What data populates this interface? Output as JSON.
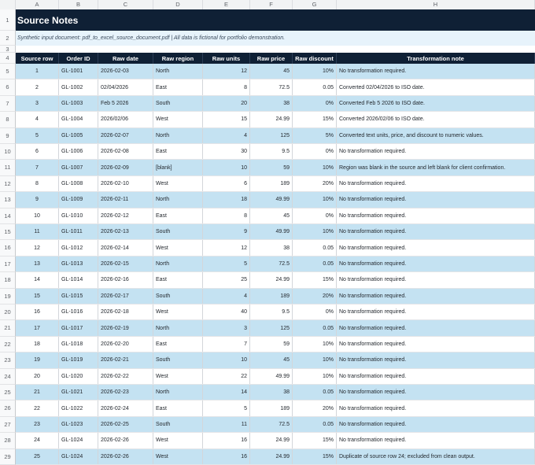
{
  "columns": [
    "A",
    "B",
    "C",
    "D",
    "E",
    "F",
    "G",
    "H"
  ],
  "title": "Source Notes",
  "subtitle": "Synthetic input document: pdf_to_excel_source_document.pdf | All data is fictional for portfolio demonstration.",
  "headers": [
    "Source row",
    "Order ID",
    "Raw date",
    "Raw region",
    "Raw units",
    "Raw price",
    "Raw discount",
    "Transformation note"
  ],
  "row_numbers": [
    "1",
    "2",
    "3",
    "4",
    "5",
    "6",
    "7",
    "8",
    "9",
    "10",
    "11",
    "12",
    "13",
    "14",
    "15",
    "16",
    "17",
    "18",
    "19",
    "20",
    "21",
    "22",
    "23",
    "24",
    "25",
    "26",
    "27",
    "28",
    "29"
  ],
  "rows": [
    [
      "1",
      "GL-1001",
      "2026-02-03",
      "North",
      "12",
      "45",
      "10%",
      "No transformation required."
    ],
    [
      "2",
      "GL-1002",
      "02/04/2026",
      "East",
      "8",
      "72.5",
      "0.05",
      "Converted 02/04/2026 to ISO date."
    ],
    [
      "3",
      "GL-1003",
      "Feb 5 2026",
      "South",
      "20",
      "38",
      "0%",
      "Converted Feb 5 2026 to ISO date."
    ],
    [
      "4",
      "GL-1004",
      "2026/02/06",
      "West",
      "15",
      "24.99",
      "15%",
      "Converted 2026/02/06 to ISO date."
    ],
    [
      "5",
      "GL-1005",
      "2026-02-07",
      "North",
      "4",
      "125",
      "5%",
      "Converted text units, price, and discount to numeric values."
    ],
    [
      "6",
      "GL-1006",
      "2026-02-08",
      "East",
      "30",
      "9.5",
      "0%",
      "No transformation required."
    ],
    [
      "7",
      "GL-1007",
      "2026-02-09",
      "[blank]",
      "10",
      "59",
      "10%",
      "Region was blank in the source and left blank for client confirmation."
    ],
    [
      "8",
      "GL-1008",
      "2026-02-10",
      "West",
      "6",
      "189",
      "20%",
      "No transformation required."
    ],
    [
      "9",
      "GL-1009",
      "2026-02-11",
      "North",
      "18",
      "49.99",
      "10%",
      "No transformation required."
    ],
    [
      "10",
      "GL-1010",
      "2026-02-12",
      "East",
      "8",
      "45",
      "0%",
      "No transformation required."
    ],
    [
      "11",
      "GL-1011",
      "2026-02-13",
      "South",
      "9",
      "49.99",
      "10%",
      "No transformation required."
    ],
    [
      "12",
      "GL-1012",
      "2026-02-14",
      "West",
      "12",
      "38",
      "0.05",
      "No transformation required."
    ],
    [
      "13",
      "GL-1013",
      "2026-02-15",
      "North",
      "5",
      "72.5",
      "0.05",
      "No transformation required."
    ],
    [
      "14",
      "GL-1014",
      "2026-02-16",
      "East",
      "25",
      "24.99",
      "15%",
      "No transformation required."
    ],
    [
      "15",
      "GL-1015",
      "2026-02-17",
      "South",
      "4",
      "189",
      "20%",
      "No transformation required."
    ],
    [
      "16",
      "GL-1016",
      "2026-02-18",
      "West",
      "40",
      "9.5",
      "0%",
      "No transformation required."
    ],
    [
      "17",
      "GL-1017",
      "2026-02-19",
      "North",
      "3",
      "125",
      "0.05",
      "No transformation required."
    ],
    [
      "18",
      "GL-1018",
      "2026-02-20",
      "East",
      "7",
      "59",
      "10%",
      "No transformation required."
    ],
    [
      "19",
      "GL-1019",
      "2026-02-21",
      "South",
      "10",
      "45",
      "10%",
      "No transformation required."
    ],
    [
      "20",
      "GL-1020",
      "2026-02-22",
      "West",
      "22",
      "49.99",
      "10%",
      "No transformation required."
    ],
    [
      "21",
      "GL-1021",
      "2026-02-23",
      "North",
      "14",
      "38",
      "0.05",
      "No transformation required."
    ],
    [
      "22",
      "GL-1022",
      "2026-02-24",
      "East",
      "5",
      "189",
      "20%",
      "No transformation required."
    ],
    [
      "23",
      "GL-1023",
      "2026-02-25",
      "South",
      "11",
      "72.5",
      "0.05",
      "No transformation required."
    ],
    [
      "24",
      "GL-1024",
      "2026-02-26",
      "West",
      "16",
      "24.99",
      "15%",
      "No transformation required."
    ],
    [
      "25",
      "GL-1024",
      "2026-02-26",
      "West",
      "16",
      "24.99",
      "15%",
      "Duplicate of source row 24; excluded from clean output."
    ]
  ],
  "colors": {
    "header_bg": "#0f2035",
    "band": "#c4e2f2",
    "subtitle_bg": "#e7f3fb"
  }
}
